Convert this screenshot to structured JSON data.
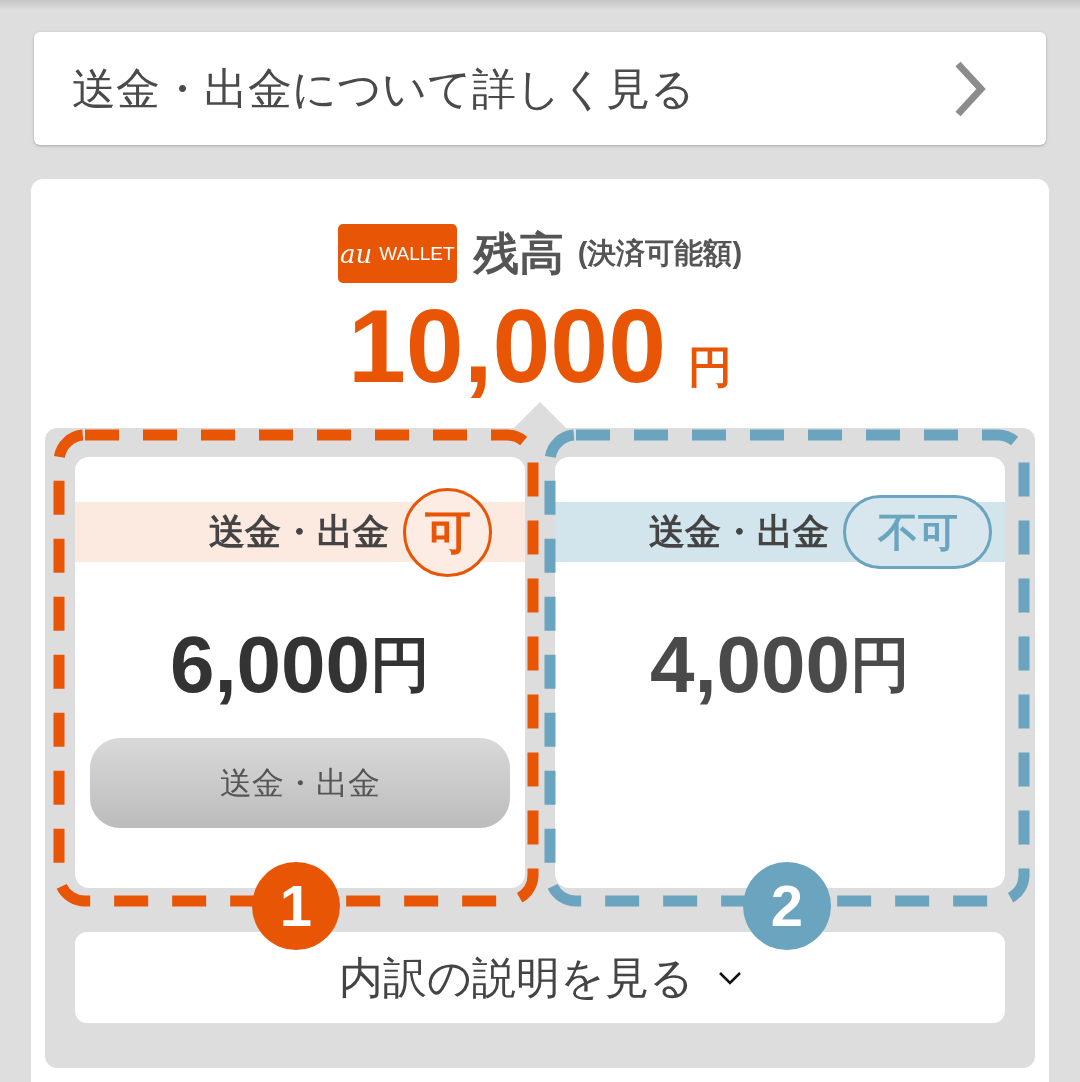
{
  "link_card": {
    "label": "送金・出金について詳しく見る"
  },
  "balance": {
    "logo": {
      "mark": "au",
      "text": "WALLET"
    },
    "title": "残高",
    "subtitle": "(決済可能額)",
    "amount": "10,000",
    "unit": "円"
  },
  "cards": [
    {
      "kind": "available",
      "color": "#e85505",
      "heading": "送金・出金",
      "status": "可",
      "amount": "6,000",
      "unit": "円",
      "button": {
        "label": "送金・出金"
      },
      "number": "1"
    },
    {
      "kind": "unavailable",
      "color": "#6aa4bf",
      "heading": "送金・出金",
      "status": "不可",
      "amount": "4,000",
      "unit": "円",
      "number": "2"
    }
  ],
  "details_toggle": {
    "label": "内訳の説明を見る",
    "expanded": false
  }
}
